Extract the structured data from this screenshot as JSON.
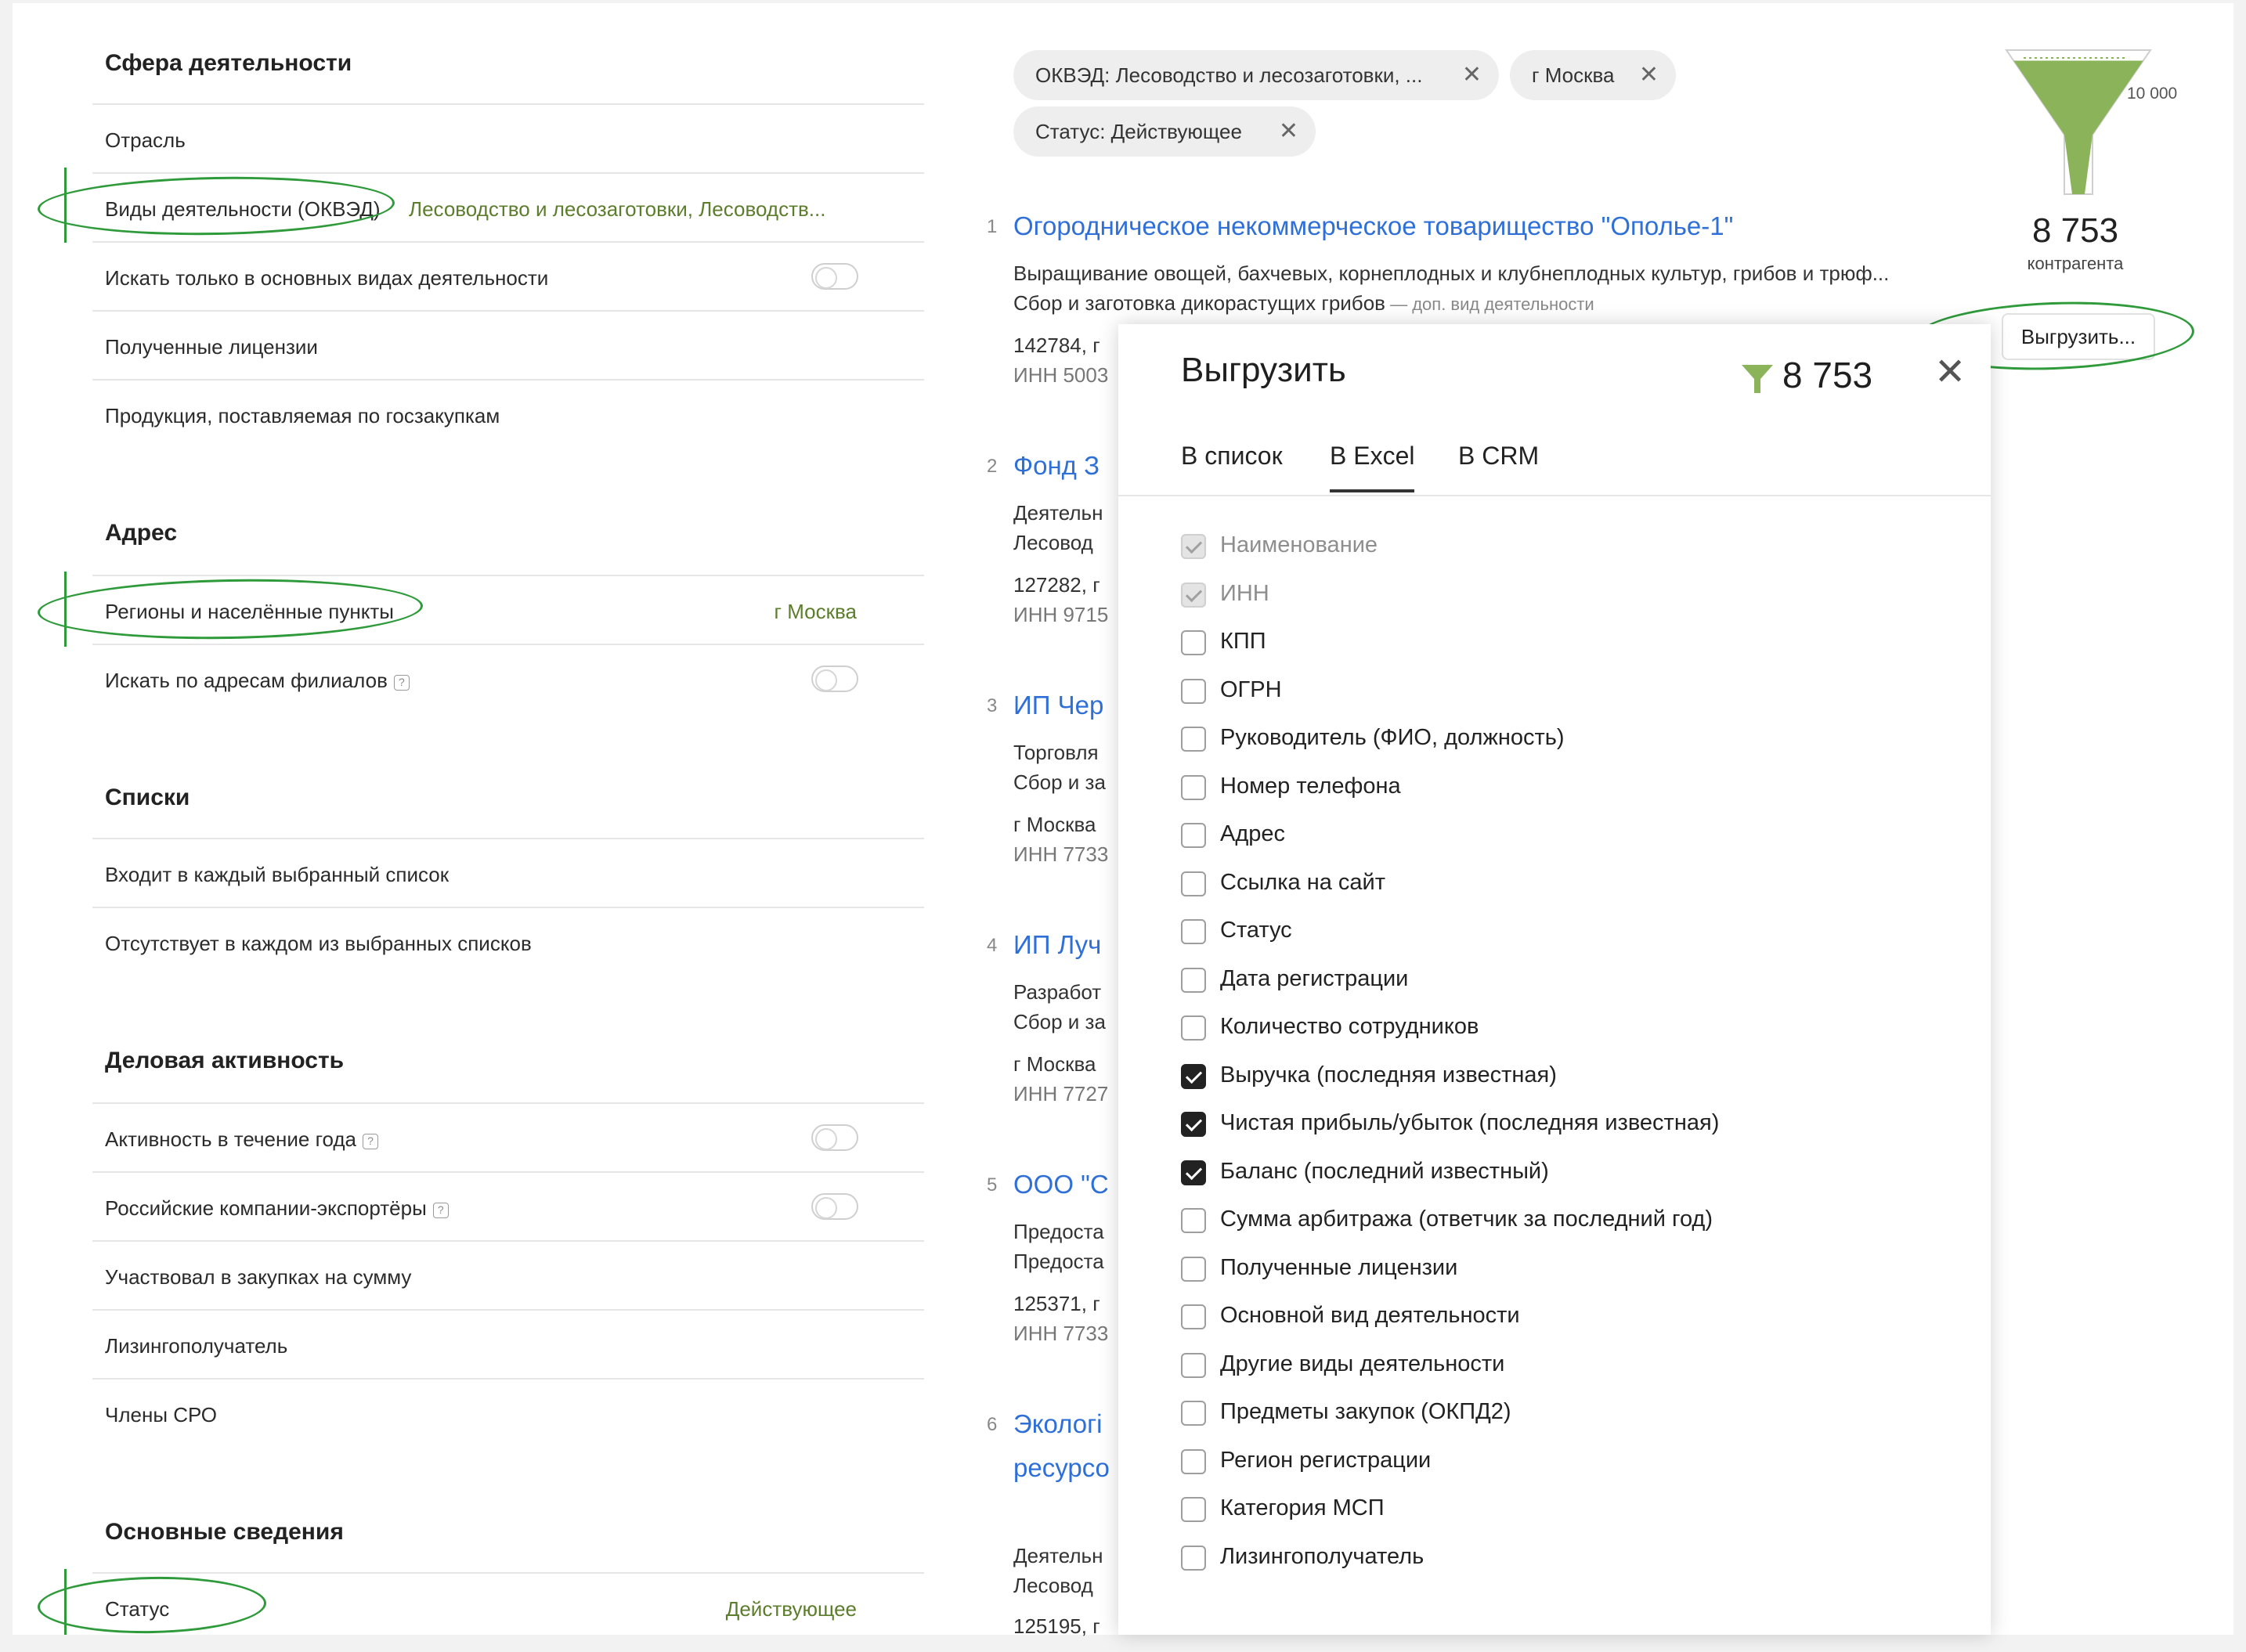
{
  "filters": {
    "activity": {
      "title": "Сфера деятельности",
      "industry": "Отрасль",
      "okved_label": "Виды деятельности (ОКВЭД)",
      "okved_value": "Лесоводство и лесозаготовки, Лесоводств...",
      "main_only": "Искать только в основных видах деятельности",
      "licenses": "Полученные лицензии",
      "goszakupki": "Продукция, поставляемая по госзакупкам"
    },
    "address": {
      "title": "Адрес",
      "regions_label": "Регионы и населённые пункты",
      "regions_value": "г Москва",
      "branches": "Искать по адресам филиалов"
    },
    "lists": {
      "title": "Списки",
      "in_each": "Входит в каждый выбранный список",
      "absent": "Отсутствует в каждом из выбранных списков"
    },
    "business": {
      "title": "Деловая активность",
      "activity_year": "Активность в течение года",
      "exporters": "Российские компании-экспортёры",
      "procurement": "Участвовал в закупках на сумму",
      "leasing": "Лизингополучатель",
      "sro": "Члены СРО"
    },
    "basic": {
      "title": "Основные сведения",
      "status_label": "Статус",
      "status_value": "Действующее"
    },
    "help_glyph": "?"
  },
  "chips": [
    {
      "label": "ОКВЭД: Лесоводство и лесозаготовки, ..."
    },
    {
      "label": "г Москва"
    },
    {
      "label": "Статус: Действующее"
    }
  ],
  "chip_close": "✕",
  "results": [
    {
      "num": "1",
      "title": "Огородническое некоммерческое товарищество \"Ополье-1\"",
      "line1": "Выращивание овощей, бахчевых, корнеплодных и клубнеплодных культур, грибов и трюф...",
      "line2": "Сбор и заготовка дикорастущих грибов",
      "note": " — доп. вид деятельности",
      "addr": "142784, г",
      "inn": "ИНН 5003"
    },
    {
      "num": "2",
      "title": "Фонд З",
      "line1": "Деятельн",
      "line2": "Лесовод",
      "addr": "127282, г",
      "inn": "ИНН 9715"
    },
    {
      "num": "3",
      "title": "ИП Чер",
      "line1": "Торговля",
      "line2": "Сбор и за",
      "addr": "г Москва",
      "inn": "ИНН 7733"
    },
    {
      "num": "4",
      "title": "ИП Луч",
      "line1": "Разработ",
      "line2": "Сбор и за",
      "addr": "г Москва",
      "inn": "ИНН 7727"
    },
    {
      "num": "5",
      "title": "ООО \"С",
      "line1": "Предоста",
      "line2": "Предоста",
      "addr": "125371, г",
      "inn": "ИНН 7733"
    },
    {
      "num": "6",
      "title": "Экологі",
      "title2": "ресурсо",
      "line1": "Деятельн",
      "line2": "Лесовод",
      "addr": "125195, г"
    }
  ],
  "funnel": {
    "max_label": "10 000",
    "count": "8 753",
    "count_label": "контрагента",
    "fill_ratio": 0.8753,
    "color": "#8ab35a"
  },
  "export_button": "Выгрузить...",
  "modal": {
    "title": "Выгрузить",
    "count": "8 753",
    "close": "✕",
    "tabs": [
      "В список",
      "В Excel",
      "В CRM"
    ],
    "active_tab": "В Excel",
    "options": [
      {
        "label": "Наименование",
        "state": "disabled"
      },
      {
        "label": "ИНН",
        "state": "disabled"
      },
      {
        "label": "КПП",
        "state": "unchecked"
      },
      {
        "label": "ОГРН",
        "state": "unchecked"
      },
      {
        "label": "Руководитель (ФИО, должность)",
        "state": "unchecked"
      },
      {
        "label": "Номер телефона",
        "state": "unchecked"
      },
      {
        "label": "Адрес",
        "state": "unchecked"
      },
      {
        "label": "Ссылка на сайт",
        "state": "unchecked"
      },
      {
        "label": "Статус",
        "state": "unchecked"
      },
      {
        "label": "Дата регистрации",
        "state": "unchecked"
      },
      {
        "label": "Количество сотрудников",
        "state": "unchecked"
      },
      {
        "label": "Выручка (последняя известная)",
        "state": "checked"
      },
      {
        "label": "Чистая прибыль/убыток (последняя известная)",
        "state": "checked"
      },
      {
        "label": "Баланс (последний известный)",
        "state": "checked"
      },
      {
        "label": "Сумма арбитража (ответчик за последний год)",
        "state": "unchecked"
      },
      {
        "label": "Полученные лицензии",
        "state": "unchecked"
      },
      {
        "label": "Основной вид деятельности",
        "state": "unchecked"
      },
      {
        "label": "Другие виды деятельности",
        "state": "unchecked"
      },
      {
        "label": "Предметы закупок (ОКПД2)",
        "state": "unchecked"
      },
      {
        "label": "Регион регистрации",
        "state": "unchecked"
      },
      {
        "label": "Категория МСП",
        "state": "unchecked"
      },
      {
        "label": "Лизингополучатель",
        "state": "unchecked"
      }
    ]
  },
  "colors": {
    "accent_green": "#5c7d2c",
    "link_blue": "#2f6fd8",
    "annotation_green": "#2e9a3a"
  }
}
